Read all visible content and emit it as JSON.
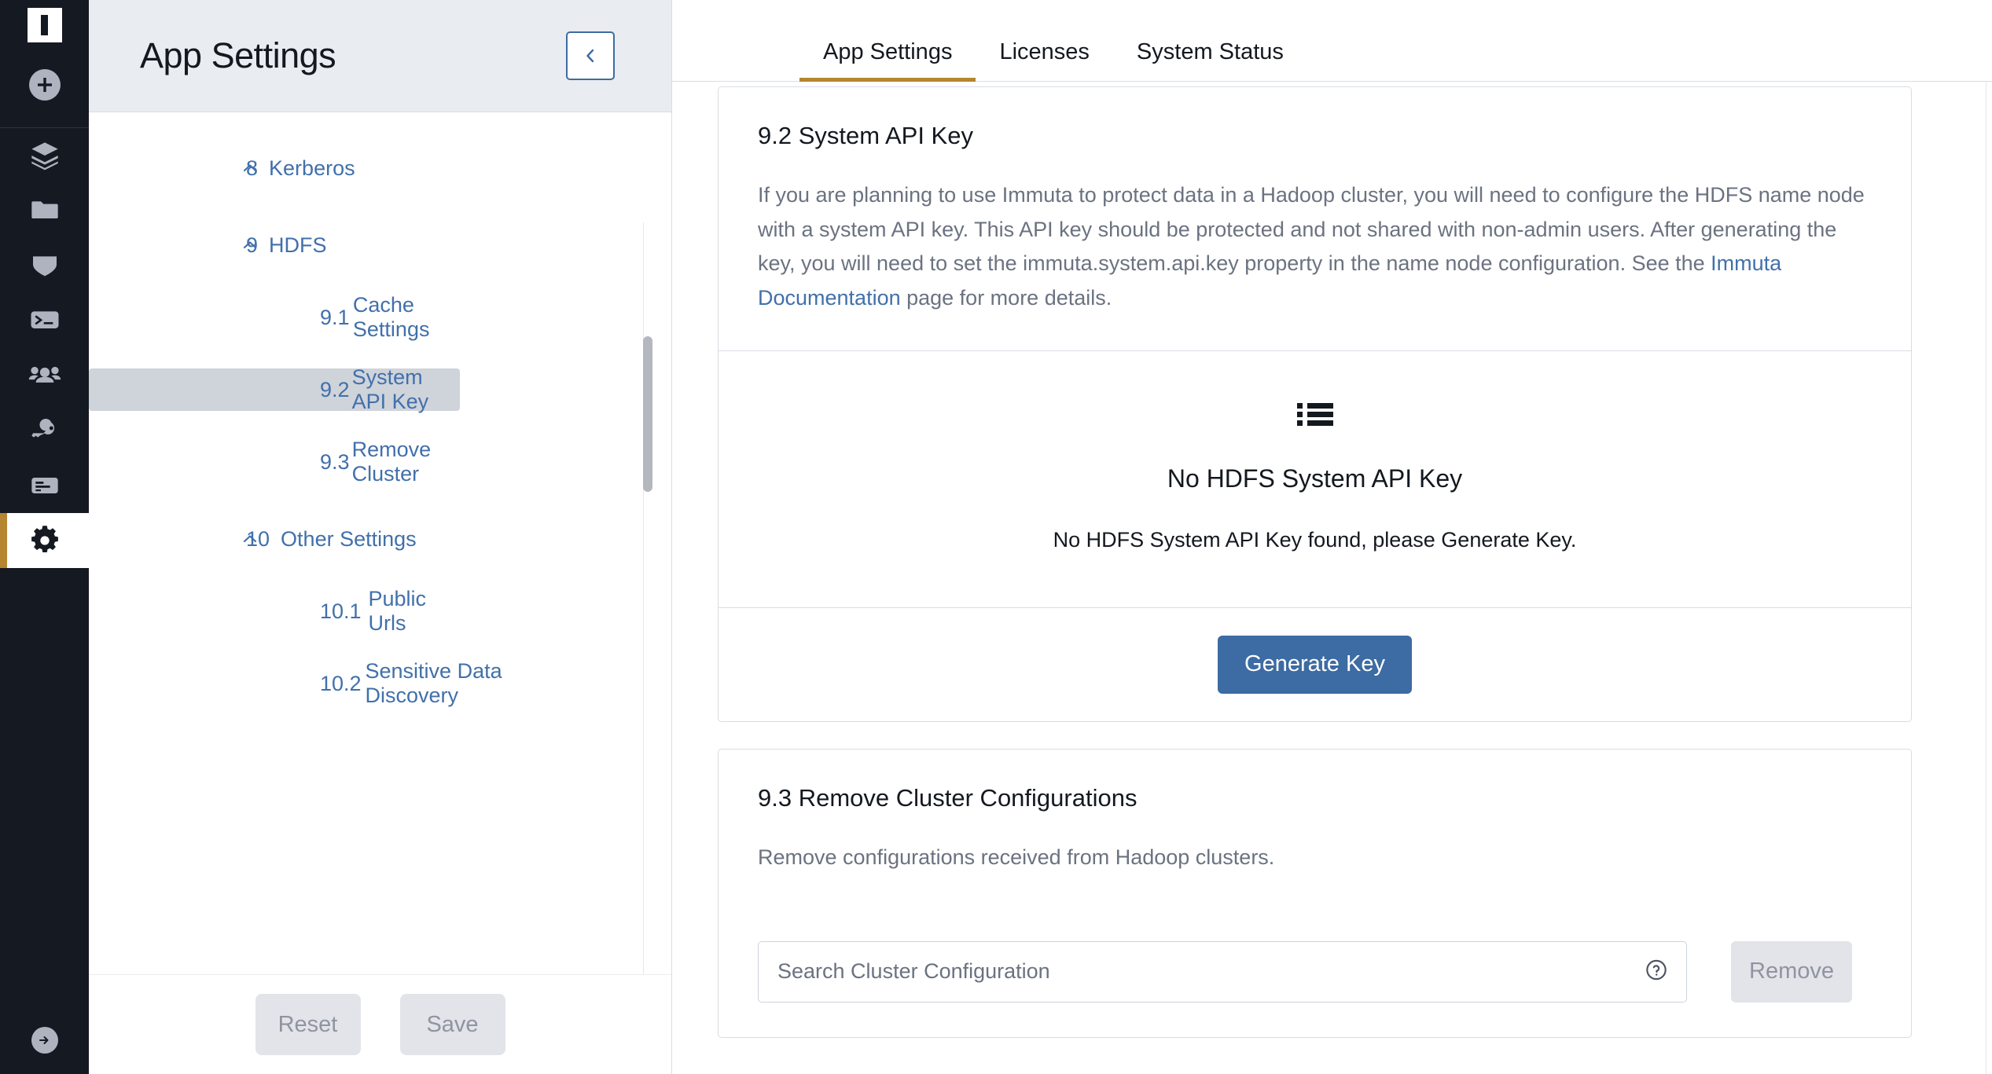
{
  "rail": {
    "logo_letter": "I",
    "items": [
      {
        "name": "add-circle-icon",
        "label": "Add"
      },
      {
        "name": "layers-icon",
        "label": "Data Sources"
      },
      {
        "name": "folder-icon",
        "label": "Projects"
      },
      {
        "name": "shield-icon",
        "label": "Policies"
      },
      {
        "name": "terminal-icon",
        "label": "Query Engine"
      },
      {
        "name": "people-icon",
        "label": "People"
      },
      {
        "name": "key-icon",
        "label": "Credentials"
      },
      {
        "name": "audit-icon",
        "label": "Audit"
      },
      {
        "name": "gear-icon",
        "label": "App Settings"
      }
    ],
    "bottom_item": {
      "name": "logout-icon",
      "label": "Sign Out"
    },
    "active_item": "gear-icon",
    "active_accent": "#b5852f",
    "background": "#151922"
  },
  "left_panel": {
    "title": "App Settings",
    "collapse_icon": "chevron-left-icon",
    "tree": [
      {
        "id": "8",
        "number": "8",
        "label": "Kerberos",
        "level": "group",
        "caret": "chevron-up-icon",
        "selected": false
      },
      {
        "id": "9",
        "number": "9",
        "label": "HDFS",
        "level": "group",
        "caret": "chevron-up-icon",
        "selected": false
      },
      {
        "id": "9.1",
        "number": "9.1",
        "label": "Cache Settings",
        "level": "child",
        "selected": false
      },
      {
        "id": "9.2",
        "number": "9.2",
        "label": "System API Key",
        "level": "child",
        "selected": true
      },
      {
        "id": "9.3",
        "number": "9.3",
        "label": "Remove Cluster",
        "level": "child",
        "selected": false
      },
      {
        "id": "10",
        "number": "10",
        "label": "Other Settings",
        "level": "group",
        "caret": "chevron-up-icon",
        "selected": false
      },
      {
        "id": "10.1",
        "number": "10.1",
        "label": "Public Urls",
        "level": "child",
        "selected": false
      },
      {
        "id": "10.2",
        "number": "10.2",
        "label": "Sensitive Data Discovery",
        "level": "child",
        "selected": false
      }
    ],
    "footer": {
      "reset_label": "Reset",
      "save_label": "Save"
    }
  },
  "tabs": [
    {
      "label": "App Settings",
      "active": true
    },
    {
      "label": "Licenses",
      "active": false
    },
    {
      "label": "System Status",
      "active": false
    }
  ],
  "main": {
    "api_key_section": {
      "heading": "9.2 System API Key",
      "paragraph_before_link": "If you are planning to use Immuta to protect data in a Hadoop cluster, you will need to configure the HDFS name node with a system API key. This API key should be protected and not shared with non-admin users. After generating the key, you will need to set the immuta.system.api.key property in the name node configuration. See the ",
      "link_text": "Immuta Documentation",
      "paragraph_after_link": " page for more details.",
      "empty_state": {
        "icon": "list-icon",
        "title": "No HDFS System API Key",
        "subtitle": "No HDFS System API Key found, please Generate Key."
      },
      "generate_button": "Generate Key",
      "generate_button_color": "#3d6ba3"
    },
    "remove_cluster_section": {
      "heading": "9.3 Remove Cluster Configurations",
      "description": "Remove configurations received from Hadoop clusters.",
      "search_placeholder": "Search Cluster Configuration",
      "help_icon": "help-circle-icon",
      "remove_button": "Remove"
    }
  }
}
